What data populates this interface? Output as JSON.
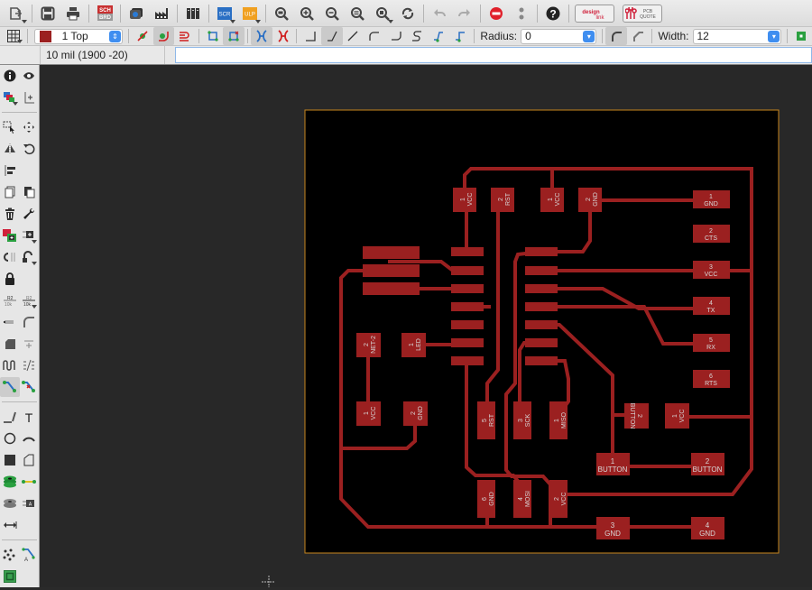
{
  "toolbar": {
    "buttons": [
      {
        "name": "open-button",
        "icon": "open-icon"
      },
      {
        "name": "save-button",
        "icon": "save-icon"
      },
      {
        "name": "print-button",
        "icon": "print-icon"
      },
      {
        "name": "sch-brd-switch-button",
        "icon": "sch-brd-icon",
        "top": "SCH",
        "bottom": "BRD"
      },
      {
        "name": "cam-button",
        "icon": "cam-icon"
      },
      {
        "name": "manufacturing-button",
        "icon": "factory-icon"
      },
      {
        "name": "library-button",
        "icon": "library-icon"
      },
      {
        "name": "script-button",
        "icon": "script-icon",
        "text": "SCR"
      },
      {
        "name": "ulp-button",
        "icon": "ulp-icon",
        "text": "ULP"
      },
      {
        "name": "zoom-fit-button",
        "icon": "zoom-fit-icon"
      },
      {
        "name": "zoom-in-button",
        "icon": "zoom-in-icon"
      },
      {
        "name": "zoom-out-button",
        "icon": "zoom-out-icon"
      },
      {
        "name": "zoom-redraw-button",
        "icon": "zoom-redraw-icon"
      },
      {
        "name": "zoom-select-button",
        "icon": "zoom-select-icon"
      },
      {
        "name": "redraw-button",
        "icon": "refresh-icon"
      },
      {
        "name": "undo-button",
        "icon": "undo-icon"
      },
      {
        "name": "redo-button",
        "icon": "redo-icon"
      },
      {
        "name": "stop-button",
        "icon": "stop-icon"
      },
      {
        "name": "go-button",
        "icon": "more-icon"
      },
      {
        "name": "help-button",
        "icon": "help-icon"
      }
    ],
    "designlink_label": "design link",
    "pcbquote_label": "PCB QUOTE"
  },
  "route_toolbar": {
    "layer": {
      "number": "1",
      "name": "1 Top",
      "color": "#9b2020"
    },
    "radius_label": "Radius:",
    "radius_value": "0",
    "width_label": "Width:",
    "width_value": "12"
  },
  "command_bar": {
    "grid_readout": "10 mil (1900 -20)",
    "command_value": ""
  },
  "left_tools": [
    [
      "info",
      "show"
    ],
    [
      "display-layers",
      "mark"
    ],
    [
      "group",
      "move"
    ],
    [
      "mirror",
      "rotate"
    ],
    [
      "align",
      ""
    ],
    [
      "copy",
      "paste"
    ],
    [
      "delete",
      "change"
    ],
    [
      "add",
      "replace"
    ],
    [
      "swap",
      "split"
    ],
    [
      "lock",
      "smash"
    ],
    [
      "name",
      "value"
    ],
    [
      "miter",
      "arc-corner"
    ],
    [
      "optimize",
      "meander"
    ],
    [
      "route",
      "ripup"
    ],
    [
      "line",
      "text"
    ],
    [
      "circle",
      "arc"
    ],
    [
      "rectangle",
      "polygon"
    ],
    [
      "via",
      "signal"
    ],
    [
      "hole",
      "attribute"
    ],
    [
      "dimension",
      ""
    ],
    [
      "ratsnest",
      "autorouter"
    ],
    [
      "drc",
      ""
    ]
  ],
  "pcb": {
    "board_outline_color": "#c8861e",
    "copper_color": "#9b2020",
    "pads": {
      "header_top": [
        {
          "num": "1",
          "name": "VCC"
        },
        {
          "num": "2",
          "name": "RST"
        },
        {
          "num": "1",
          "name": "VCC"
        },
        {
          "num": "2",
          "name": "GND"
        }
      ],
      "ftdi": [
        {
          "num": "1",
          "name": "GND"
        },
        {
          "num": "2",
          "name": "CTS"
        },
        {
          "num": "3",
          "name": "VCC"
        },
        {
          "num": "4",
          "name": "TX"
        },
        {
          "num": "5",
          "name": "RX"
        },
        {
          "num": "6",
          "name": "RTS"
        }
      ],
      "led_res": [
        {
          "num": "2",
          "name": "NET-2"
        },
        {
          "num": "1",
          "name": "LED"
        },
        {
          "num": "1",
          "name": "VCC"
        },
        {
          "num": "2",
          "name": "GND"
        }
      ],
      "isp_top": [
        {
          "num": "5",
          "name": "RST"
        },
        {
          "num": "3",
          "name": "SCK"
        },
        {
          "num": "1",
          "name": "MISO"
        }
      ],
      "isp_bottom": [
        {
          "num": "6",
          "name": "GND"
        },
        {
          "num": "4",
          "name": "MOSI"
        },
        {
          "num": "2",
          "name": "VCC"
        }
      ],
      "button_area": [
        {
          "num": "2",
          "name": "BUTTON"
        },
        {
          "num": "1",
          "name": "VCC"
        },
        {
          "num": "1",
          "name": "BUTTON"
        },
        {
          "num": "2",
          "name": "BUTTON"
        },
        {
          "num": "3",
          "name": "GND"
        },
        {
          "num": "4",
          "name": "GND"
        }
      ]
    }
  }
}
